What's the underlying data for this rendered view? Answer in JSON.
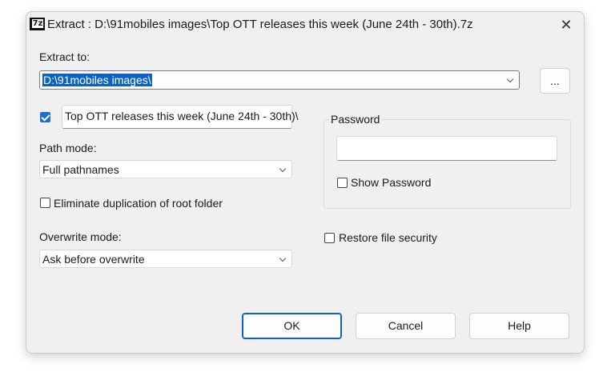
{
  "window": {
    "title": "Extract : D:\\91mobiles images\\Top OTT releases this week (June 24th - 30th).7z",
    "app_icon_text": "7z",
    "close_glyph": "✕"
  },
  "extract_to": {
    "label": "Extract to:",
    "value": "D:\\91mobiles images\\",
    "browse_label": "..."
  },
  "subfolder": {
    "checked": true,
    "value": "Top OTT releases this week (June 24th - 30th)\\"
  },
  "path_mode": {
    "label": "Path mode:",
    "selected": "Full pathnames"
  },
  "eliminate_duplication": {
    "label": "Eliminate duplication of root folder",
    "checked": false
  },
  "overwrite_mode": {
    "label": "Overwrite mode:",
    "selected": "Ask before overwrite"
  },
  "password": {
    "group_label": "Password",
    "value": "",
    "show_password_label": "Show Password",
    "show_password_checked": false
  },
  "restore_security": {
    "label": "Restore file security",
    "checked": false
  },
  "buttons": {
    "ok": "OK",
    "cancel": "Cancel",
    "help": "Help"
  }
}
